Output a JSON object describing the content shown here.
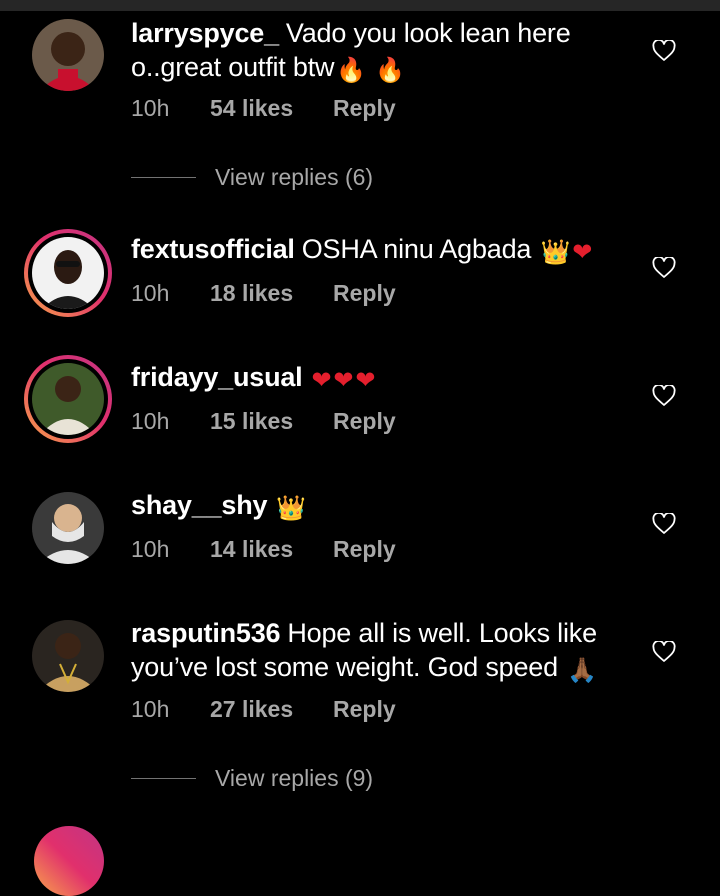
{
  "comments": [
    {
      "username": "larryspyce_",
      "text": "Vado you look lean here o..great outfit btw",
      "emoji": [
        "🔥",
        "🔥"
      ],
      "time": "10h",
      "likes": "54 likes",
      "reply": "Reply",
      "view_replies": "View replies (6)",
      "story_ring": false,
      "avatar_icon": "avatar-photo"
    },
    {
      "username": "fextusofficial",
      "text": "OSHA ninu Agbada",
      "emoji": [
        "👑",
        "❤"
      ],
      "time": "10h",
      "likes": "18 likes",
      "reply": "Reply",
      "story_ring": true,
      "avatar_icon": "avatar-photo"
    },
    {
      "username": "fridayy_usual",
      "text": "",
      "emoji": [
        "❤",
        "❤",
        "❤"
      ],
      "time": "10h",
      "likes": "15 likes",
      "reply": "Reply",
      "story_ring": true,
      "avatar_icon": "avatar-photo"
    },
    {
      "username": "shay__shy",
      "text": "",
      "emoji": [
        "👑"
      ],
      "time": "10h",
      "likes": "14 likes",
      "reply": "Reply",
      "story_ring": false,
      "avatar_icon": "avatar-photo"
    },
    {
      "username": "rasputin536",
      "text": "Hope all is well. Looks like you’ve lost some weight. God speed",
      "emoji": [
        "🙏🏾"
      ],
      "time": "10h",
      "likes": "27 likes",
      "reply": "Reply",
      "view_replies": "View replies (9)",
      "story_ring": false,
      "avatar_icon": "avatar-photo"
    }
  ],
  "icons": {
    "like": "heart-outline-icon"
  },
  "colors": {
    "background": "#000000",
    "text": "#ffffff",
    "secondary_text": "#a8a8a8",
    "story_ring_start": "#f9a64a",
    "story_ring_end": "#c13584"
  }
}
